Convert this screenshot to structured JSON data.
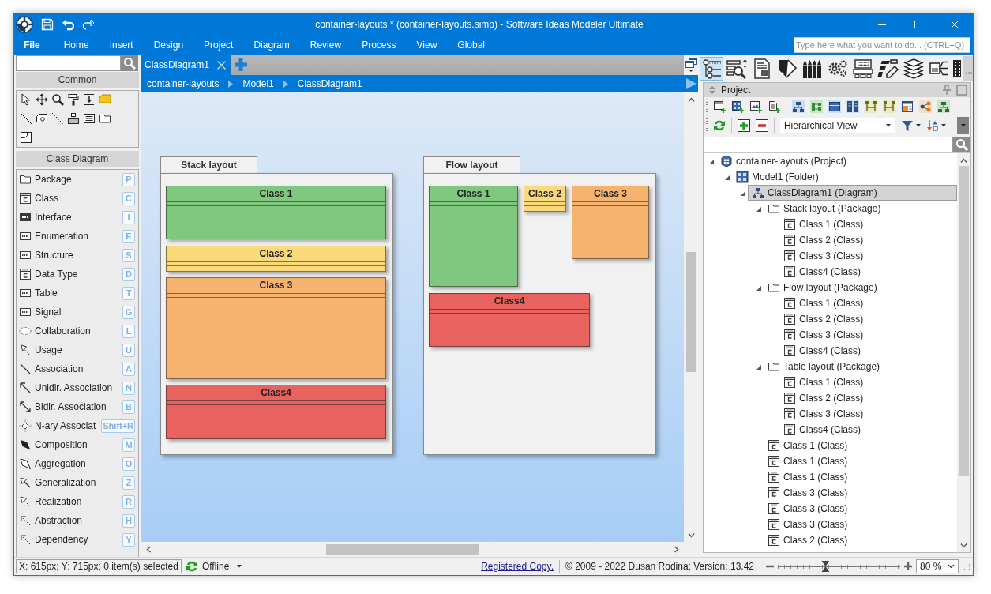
{
  "window": {
    "title": "container-layouts * (container-layouts.simp) - Software Ideas Modeler Ultimate"
  },
  "menu": [
    {
      "label": "File",
      "kind": "backstage"
    },
    {
      "label": "Home",
      "kind": "tab"
    },
    {
      "label": "Insert",
      "kind": "tab"
    },
    {
      "label": "Design",
      "kind": "tab"
    },
    {
      "label": "Project",
      "kind": "tab"
    },
    {
      "label": "Diagram",
      "kind": "tab"
    },
    {
      "label": "Review",
      "kind": "tab"
    },
    {
      "label": "Process",
      "kind": "tab"
    },
    {
      "label": "View",
      "kind": "tab"
    },
    {
      "label": "Global",
      "kind": "tab"
    }
  ],
  "quick_search": {
    "placeholder": "Type here what you want to do... (CTRL+Q)"
  },
  "toolbox": {
    "sections": [
      {
        "title": "Common",
        "kind": "tools"
      },
      {
        "title": "Class Diagram",
        "kind": "list",
        "items": [
          {
            "label": "Package",
            "shortcut": "P"
          },
          {
            "label": "Class",
            "shortcut": "C"
          },
          {
            "label": "Interface",
            "shortcut": "I"
          },
          {
            "label": "Enumeration",
            "shortcut": "E"
          },
          {
            "label": "Structure",
            "shortcut": "S"
          },
          {
            "label": "Data Type",
            "shortcut": "D"
          },
          {
            "label": "Table",
            "shortcut": "T"
          },
          {
            "label": "Signal",
            "shortcut": "G"
          },
          {
            "label": "Collaboration",
            "shortcut": "L"
          },
          {
            "label": "Usage",
            "shortcut": "U"
          },
          {
            "label": "Association",
            "shortcut": "A"
          },
          {
            "label": "Unidir. Association",
            "shortcut": "N"
          },
          {
            "label": "Bidir. Association",
            "shortcut": "B"
          },
          {
            "label": "N-ary Associat",
            "shortcut": "Shift+R"
          },
          {
            "label": "Composition",
            "shortcut": "M"
          },
          {
            "label": "Aggregation",
            "shortcut": "O"
          },
          {
            "label": "Generalization",
            "shortcut": "Z"
          },
          {
            "label": "Realization",
            "shortcut": "R"
          },
          {
            "label": "Abstraction",
            "shortcut": "H"
          },
          {
            "label": "Dependency",
            "shortcut": "Y"
          }
        ]
      }
    ]
  },
  "document_tabs": [
    {
      "label": "ClassDiagram1",
      "selected": true
    }
  ],
  "breadcrumb": [
    "container-layouts",
    "Model1",
    "ClassDiagram1"
  ],
  "diagram": {
    "packages": [
      {
        "name": "Stack layout",
        "classes": [
          {
            "name": "Class 1",
            "color": "#80c77f"
          },
          {
            "name": "Class 2",
            "color": "#f9d97a"
          },
          {
            "name": "Class 3",
            "color": "#f6b26f"
          },
          {
            "name": "Class4",
            "color": "#e8625e"
          }
        ]
      },
      {
        "name": "Flow layout",
        "classes": [
          {
            "name": "Class 1",
            "color": "#80c77f"
          },
          {
            "name": "Class 2",
            "color": "#f9d97a"
          },
          {
            "name": "Class 3",
            "color": "#f6b26f"
          },
          {
            "name": "Class4",
            "color": "#e8625e"
          }
        ]
      }
    ]
  },
  "panel_switcher": [
    {
      "selected": true
    },
    {
      "selected": false
    },
    {
      "selected": false
    },
    {
      "selected": false
    },
    {
      "selected": false
    },
    {
      "selected": false
    },
    {
      "selected": false
    },
    {
      "selected": false
    },
    {
      "selected": false
    },
    {
      "selected": false
    },
    {
      "selected": false
    }
  ],
  "project_panel": {
    "title": "Project",
    "view": "Hierarchical View",
    "tree": [
      {
        "label": "container-layouts (Project)",
        "kind": "project",
        "expanded": true,
        "selected": false,
        "children": [
          {
            "label": "Model1 (Folder)",
            "kind": "folder",
            "expanded": true,
            "selected": false,
            "children": [
              {
                "label": "ClassDiagram1 (Diagram)",
                "kind": "diagram",
                "expanded": true,
                "selected": true,
                "children": [
                  {
                    "label": "Stack layout (Package)",
                    "kind": "package",
                    "expanded": true,
                    "selected": false,
                    "children": [
                      {
                        "label": "Class 1 (Class)",
                        "kind": "class",
                        "selected": false
                      },
                      {
                        "label": "Class 2 (Class)",
                        "kind": "class",
                        "selected": false
                      },
                      {
                        "label": "Class 3 (Class)",
                        "kind": "class",
                        "selected": false
                      },
                      {
                        "label": "Class4 (Class)",
                        "kind": "class",
                        "selected": false
                      }
                    ]
                  },
                  {
                    "label": "Flow layout (Package)",
                    "kind": "package",
                    "expanded": true,
                    "selected": false,
                    "children": [
                      {
                        "label": "Class 1 (Class)",
                        "kind": "class",
                        "selected": false
                      },
                      {
                        "label": "Class 2 (Class)",
                        "kind": "class",
                        "selected": false
                      },
                      {
                        "label": "Class 3 (Class)",
                        "kind": "class",
                        "selected": false
                      },
                      {
                        "label": "Class4 (Class)",
                        "kind": "class",
                        "selected": false
                      }
                    ]
                  },
                  {
                    "label": "Table layout (Package)",
                    "kind": "package",
                    "expanded": true,
                    "selected": false,
                    "children": [
                      {
                        "label": "Class 1 (Class)",
                        "kind": "class",
                        "selected": false
                      },
                      {
                        "label": "Class 2 (Class)",
                        "kind": "class",
                        "selected": false
                      },
                      {
                        "label": "Class 3 (Class)",
                        "kind": "class",
                        "selected": false
                      },
                      {
                        "label": "Class4 (Class)",
                        "kind": "class",
                        "selected": false
                      }
                    ]
                  },
                  {
                    "label": "Class 1 (Class)",
                    "kind": "class",
                    "selected": false
                  },
                  {
                    "label": "Class 1 (Class)",
                    "kind": "class",
                    "selected": false
                  },
                  {
                    "label": "Class 1 (Class)",
                    "kind": "class",
                    "selected": false
                  },
                  {
                    "label": "Class 3 (Class)",
                    "kind": "class",
                    "selected": false
                  },
                  {
                    "label": "Class 3 (Class)",
                    "kind": "class",
                    "selected": false
                  },
                  {
                    "label": "Class 3 (Class)",
                    "kind": "class",
                    "selected": false
                  },
                  {
                    "label": "Class 2 (Class)",
                    "kind": "class",
                    "selected": false
                  }
                ]
              }
            ]
          }
        ]
      }
    ]
  },
  "status_bar": {
    "position": "X: 615px; Y: 715px; 0 item(s) selected",
    "connection": "Offline",
    "license_link": "Registered Copy.",
    "copyright": "© 2009 - 2022 Dusan Rodina; Version: 13.42",
    "zoom": {
      "level": 0.39,
      "value": "80 %"
    }
  }
}
